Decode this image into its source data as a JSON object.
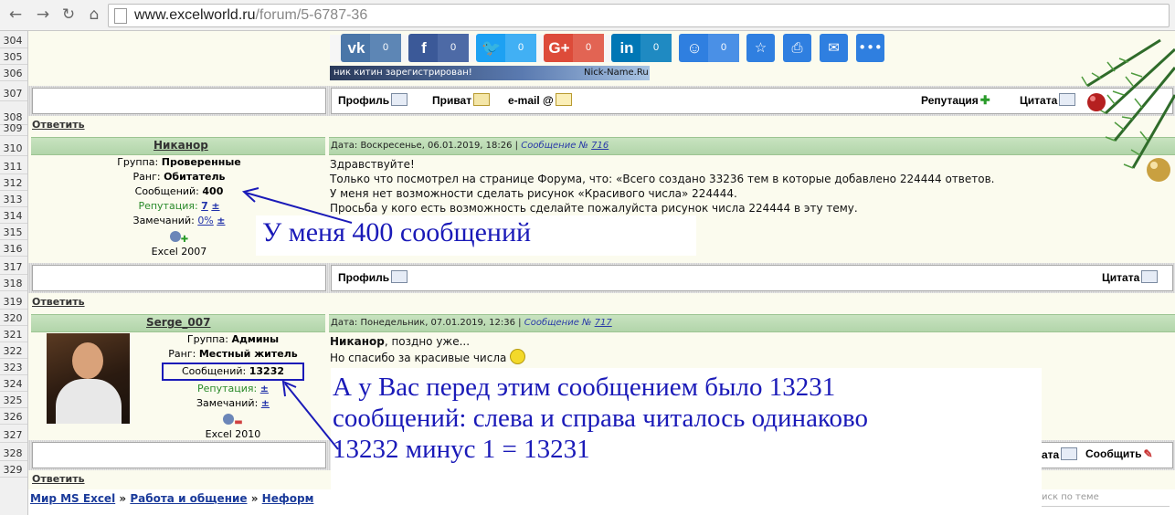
{
  "browser": {
    "url_host": "www.excelworld.ru",
    "url_path": "/forum/5-6787-36"
  },
  "rows": [
    "304",
    "305",
    "306",
    "307",
    "308",
    "309",
    "310",
    "311",
    "312",
    "313",
    "314",
    "315",
    "316",
    "317",
    "318",
    "319",
    "320",
    "321",
    "322",
    "323",
    "324",
    "325",
    "326",
    "327",
    "328",
    "329"
  ],
  "share": {
    "items": [
      {
        "icon": "vk",
        "count": "0"
      },
      {
        "icon": "f",
        "count": "0"
      },
      {
        "icon": "🐦",
        "count": "0"
      },
      {
        "icon": "G+",
        "count": "0"
      },
      {
        "icon": "in",
        "count": "0"
      },
      {
        "icon": "☺",
        "count": "0"
      }
    ],
    "colors": [
      "#4a76a8",
      "#3b5998",
      "#1da1f2",
      "#dd4b39",
      "#0077b5",
      "#2f7fe0"
    ]
  },
  "banner": {
    "text": "ник китин зарегистрирован!",
    "site": "Nick-Name.Ru"
  },
  "toolbar1": {
    "profile": "Профиль",
    "private": "Приват",
    "email": "e-mail @",
    "reputation": "Репутация",
    "quote": "Цитата"
  },
  "reply": "Ответить",
  "post1": {
    "author": "Никанор",
    "date": "Дата: Воскресенье, 06.01.2019, 18:26 | ",
    "msg_label": "Сообщение № ",
    "msg_no": "716",
    "group_label": "Группа: ",
    "group": "Проверенные",
    "rank_label": "Ранг: ",
    "rank": "Обитатель",
    "posts_label": "Сообщений: ",
    "posts": "400",
    "rep_label": "Репутация: ",
    "rep": "7",
    "plus": "±",
    "warn_label": "Замечаний: ",
    "warn": "0%",
    "software": "Excel 2007",
    "lines": [
      "Здравствуйте!",
      "Только что посмотрел на странице Форума, что: «Всего создано 33236 тем в которые добавлено 224444 ответов.",
      "У меня нет возможности сделать рисунок «Красивого числа» 224444.",
      "Просьба у кого есть возможность сделайте пожалуйста рисунок числа 224444 в эту тему."
    ]
  },
  "annotation1": "У меня 400 сообщений",
  "toolbar2": {
    "profile": "Профиль",
    "quote": "Цитата"
  },
  "post2": {
    "author": "Serge_007",
    "date": "Дата: Понедельник, 07.01.2019, 12:36 | ",
    "msg_label": "Сообщение № ",
    "msg_no": "717",
    "group_label": "Группа: ",
    "group": "Админы",
    "rank_label": "Ранг: ",
    "rank": "Местный житель",
    "posts_label": "Сообщений: ",
    "posts": "13232",
    "rep_label": "Репутация: ",
    "plus": "±",
    "warn_label": "Замечаний: ",
    "software": "Excel 2010",
    "line1_name": "Никанор",
    "line1_rest": ", поздно уже...",
    "line2": "Но спасибо за красивые числа"
  },
  "annotation2": [
    "А у Вас перед этим сообщением было 13231",
    "сообщений: слева и справа читалось одинаково",
    "13232 минус 1 = 13231"
  ],
  "toolbar3": {
    "quote_tail": "ата",
    "report": "Сообщить"
  },
  "breadcrumb": {
    "home": "Мир MS Excel",
    "sep": "»",
    "section": "Работа и общение",
    "forum": "Неформ"
  },
  "search_placeholder": "иск по теме"
}
